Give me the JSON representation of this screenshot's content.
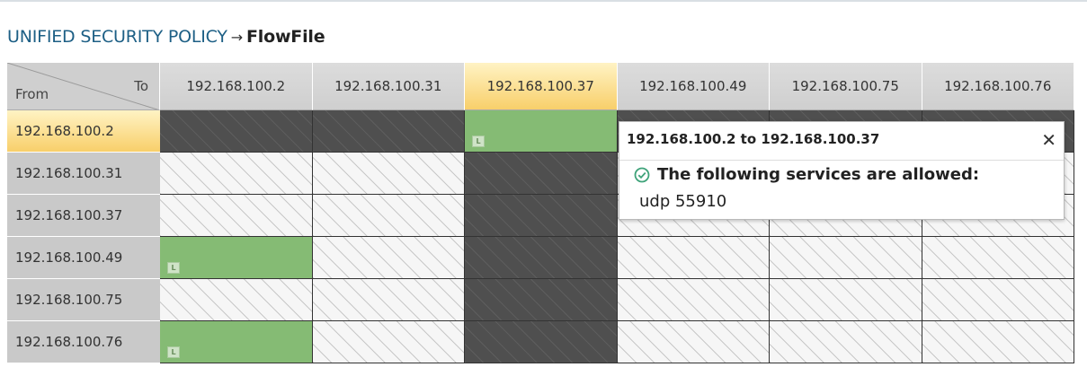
{
  "breadcrumb": {
    "parent": "UNIFIED SECURITY POLICY",
    "separator": "→",
    "current": "FlowFile"
  },
  "matrix": {
    "corner": {
      "to_label": "To",
      "from_label": "From"
    },
    "columns": [
      "192.168.100.2",
      "192.168.100.31",
      "192.168.100.37",
      "192.168.100.49",
      "192.168.100.75",
      "192.168.100.76"
    ],
    "rows": [
      "192.168.100.2",
      "192.168.100.31",
      "192.168.100.37",
      "192.168.100.49",
      "192.168.100.75",
      "192.168.100.76"
    ],
    "selected_column": "192.168.100.37",
    "selected_row": "192.168.100.2",
    "badge_label": "L",
    "cells": [
      [
        "dark",
        "dark",
        "allow",
        "dark",
        "dark",
        "dark"
      ],
      [
        "blank",
        "blank",
        "dark",
        "blank",
        "blank",
        "blank"
      ],
      [
        "blank",
        "blank",
        "dark",
        "blank",
        "blank",
        "blank"
      ],
      [
        "allow",
        "blank",
        "dark",
        "blank",
        "blank",
        "blank"
      ],
      [
        "blank",
        "blank",
        "dark",
        "blank",
        "blank",
        "blank"
      ],
      [
        "allow",
        "blank",
        "dark",
        "blank",
        "blank",
        "blank"
      ]
    ]
  },
  "popup": {
    "title": "192.168.100.2 to 192.168.100.37",
    "close_icon": "close-icon",
    "status_icon": "check-circle-icon",
    "message": "The following services are allowed:",
    "services": "udp 55910"
  },
  "colors": {
    "allow": "#85bb74",
    "dark": "#4f4f4f",
    "selected": "#f8cf6a",
    "breadcrumb_link": "#1d5f85"
  }
}
